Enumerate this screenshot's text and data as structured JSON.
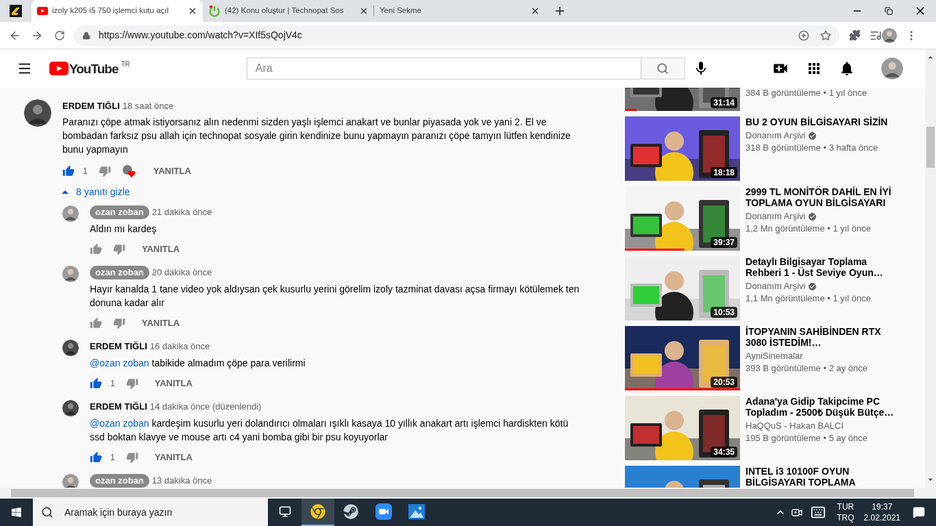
{
  "tabs": [
    {
      "title": "izoly k205 i5 750 işlemci kutu açıl",
      "selected": true,
      "kind": "youtube"
    },
    {
      "title": "(42) Konu oluştur | Technopat Sos",
      "selected": false,
      "kind": "power"
    },
    {
      "title": "Yeni Sekme",
      "selected": false,
      "kind": "blank"
    }
  ],
  "address_bar": {
    "url": "https://www.youtube.com/watch?v=XIf5sQojV4c"
  },
  "youtube_header": {
    "logo": "YouTube",
    "region": "TR",
    "search": {
      "placeholder": "Ara"
    }
  },
  "comments": [
    {
      "author": "ERDEM TIĞLI",
      "time": "18 saat önce",
      "text": "Paranızı çöpe atmak istiyorsanız alın nedenmi sizden yaşlı işlemci anakart ve bunlar piyasada yok ve yani 2. El ve bombadan farksız psu allah için technopat sosyale girin kendinize bunu yapmayın paranızı çöpe tamyın lütfen kendinize bunu yapmayın",
      "likes": "1",
      "liked": true,
      "hearted": true,
      "reply_label": "YANITLA",
      "replies_toggle": "8 yanıtı gizle",
      "expanded": true,
      "replies": [
        {
          "author": "ozan zoban",
          "owner": true,
          "time": "21 dakika önce",
          "text": "Aldın mı kardeş",
          "liked": false,
          "reply_label": "YANITLA"
        },
        {
          "author": "ozan zoban",
          "owner": true,
          "time": "20 dakika önce",
          "text": "Hayır kanalda 1 tane video yok aldıysan çek kusurlu yerini görelim izoly tazminat davası açsa firmayı kötülemek ten donuna kadar alır",
          "liked": false,
          "reply_label": "YANITLA"
        },
        {
          "author": "ERDEM TIĞLI",
          "owner": false,
          "time": "16 dakika önce",
          "mention": "@ozan zoban",
          "text": "tabikide almadım çöpe para verilirmi",
          "likes": "1",
          "liked": true,
          "reply_label": "YANITLA"
        },
        {
          "author": "ERDEM TIĞLI",
          "owner": false,
          "time": "14 dakika önce (düzenlendi)",
          "mention": "@ozan zoban",
          "text": "kardeşim kusurlu yeri dolandırıcı olmaları ışıklı kasaya 10 yıllık anakart artı işlemci hardiskten kötü ssd boktan klavye ve mouse artı c4 yani bomba gibi bir psu koyuyorlar",
          "likes": "1",
          "liked": true,
          "reply_label": "YANITLA"
        },
        {
          "author": "ozan zoban",
          "owner": true,
          "time": "13 dakika önce"
        }
      ]
    }
  ],
  "videos": [
    {
      "meta": "384 B görüntüleme • 1 yıl önce",
      "duration": "31:14",
      "level": 0.1
    },
    {
      "title": "BU 2 OYUN BİLGİSAYARI SİZİN",
      "channel": "Donanım Arşivi",
      "verified": true,
      "meta": "318 B görüntüleme • 3 hafta önce",
      "duration": "18:18"
    },
    {
      "title": "2999 TL MONİTÖR DAHİL EN İYİ TOPLAMA OYUN BİLGİSAYARI",
      "channel": "Donanım Arşivi",
      "verified": true,
      "meta": "1,2 Mn görüntüleme • 1 yıl önce",
      "duration": "39:37",
      "level": 0.52
    },
    {
      "title": "Detaylı Bilgisayar Toplama Rehberi 1 - Üst Seviye Oyun…",
      "channel": "Donanım Arşivi",
      "verified": true,
      "meta": "1,1 Mn görüntüleme • 1 yıl önce",
      "duration": "10:53"
    },
    {
      "title": "İTOPYANIN SAHİBİNDEN RTX 3080 İSTEDİM!…",
      "channel": "AyniSinemalar",
      "meta": "393 B görüntüleme • 2 ay önce",
      "duration": "20:53",
      "level": 1
    },
    {
      "title": "Adana'ya Gidip Takipcime PC Topladım - 2500₺ Düşük Bütçe…",
      "channel": "HaQQuS - Hakan BALCI",
      "meta": "195 B görüntüleme • 5 ay önce",
      "duration": "34:35"
    },
    {
      "title": "INTEL i3 10100F OYUN BİLGİSAYARI TOPLAMA"
    }
  ],
  "taskbar": {
    "search": {
      "placeholder": "Aramak için buraya yazın"
    },
    "apps": [
      {
        "kind": "taskview",
        "selected": false
      },
      {
        "kind": "chrome",
        "selected": true
      },
      {
        "kind": "steam",
        "selected": false
      },
      {
        "kind": "zoom",
        "selected": false
      },
      {
        "kind": "photos",
        "selected": false
      }
    ],
    "language": "TUR",
    "layout": "TRQ",
    "time": "19:37",
    "date": "2.02.2021"
  }
}
